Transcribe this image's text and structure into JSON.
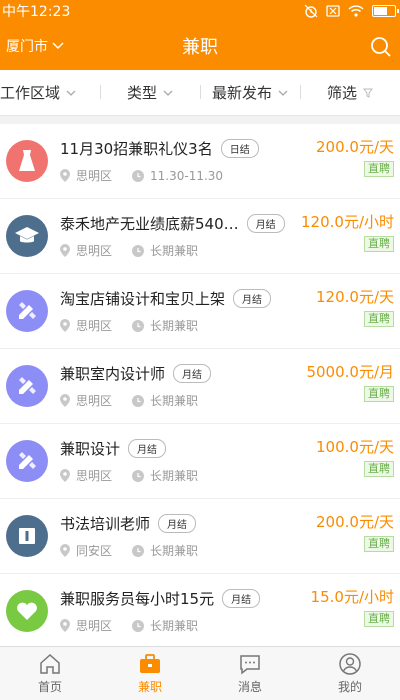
{
  "status": {
    "time": "中午12:23"
  },
  "header": {
    "city": "厦门市",
    "title": "兼职"
  },
  "filters": [
    "工作区域",
    "类型",
    "最新发布",
    "筛选"
  ],
  "jobs": [
    {
      "title": "11月30招兼职礼仪3名",
      "settle": "日结",
      "district": "思明区",
      "period": "11.30-11.30",
      "price": "200.0元/天",
      "tag": "直聘",
      "icon": "dress-icon",
      "color": "#f0736f"
    },
    {
      "title": "泰禾地产无业绩底薪540…",
      "settle": "月结",
      "district": "思明区",
      "period": "长期兼职",
      "price": "120.0元/小时",
      "tag": "直聘",
      "icon": "graduation-cap-icon",
      "color": "#4e6e8e"
    },
    {
      "title": "淘宝店铺设计和宝贝上架",
      "settle": "月结",
      "district": "思明区",
      "period": "长期兼职",
      "price": "120.0元/天",
      "tag": "直聘",
      "icon": "pencil-ruler-icon",
      "color": "#8d8ef5"
    },
    {
      "title": "兼职室内设计师",
      "settle": "月结",
      "district": "思明区",
      "period": "长期兼职",
      "price": "5000.0元/月",
      "tag": "直聘",
      "icon": "pencil-ruler-icon",
      "color": "#8d8ef5"
    },
    {
      "title": "兼职设计",
      "settle": "月结",
      "district": "思明区",
      "period": "长期兼职",
      "price": "100.0元/天",
      "tag": "直聘",
      "icon": "pencil-ruler-icon",
      "color": "#8d8ef5"
    },
    {
      "title": "书法培训老师",
      "settle": "月结",
      "district": "同安区",
      "period": "长期兼职",
      "price": "200.0元/天",
      "tag": "直聘",
      "icon": "book-icon",
      "color": "#4e6e8e"
    },
    {
      "title": "兼职服务员每小时15元",
      "settle": "月结",
      "district": "思明区",
      "period": "长期兼职",
      "price": "15.0元/小时",
      "tag": "直聘",
      "icon": "heart-icon",
      "color": "#7ac943"
    }
  ],
  "tabs": [
    "首页",
    "兼职",
    "消息",
    "我的"
  ]
}
